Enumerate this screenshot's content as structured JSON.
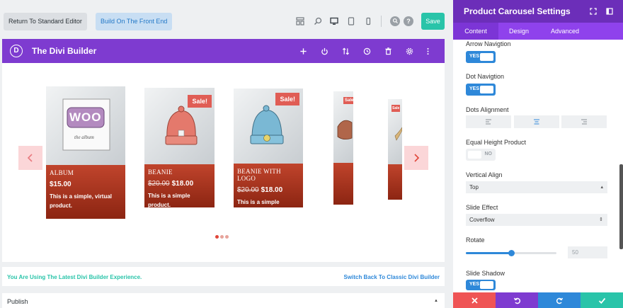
{
  "toolbar": {
    "return_label": "Return To Standard Editor",
    "front_end_label": "Build On The Front End",
    "save_label": "Save",
    "help_label": "?"
  },
  "builder": {
    "title": "The Divi Builder",
    "logo_letter": "D"
  },
  "carousel": {
    "products": [
      {
        "name": "ALBUM",
        "price": "$15.00",
        "old_price": "",
        "description": "This is a simple, virtual product.",
        "sale": ""
      },
      {
        "name": "BEANIE",
        "price": "$18.00",
        "old_price": "$20.00",
        "description": "This is a simple product.",
        "sale": "Sale!"
      },
      {
        "name": "BEANIE WITH LOGO",
        "price": "$18.00",
        "old_price": "$20.00",
        "description": "This is a simple product.",
        "sale": "Sale!"
      },
      {
        "name": "",
        "price": "",
        "old_price": "",
        "description": "",
        "sale": "Sale"
      },
      {
        "name": "",
        "price": "",
        "old_price": "",
        "description": "",
        "sale": "Sale"
      }
    ],
    "album_art_text": "WOO",
    "album_art_sub": "the album",
    "dots_total": 3,
    "dots_active": 0
  },
  "infobar": {
    "left": "You Are Using The Latest Divi Builder Experience.",
    "right": "Switch Back To Classic Divi Builder"
  },
  "publish": {
    "label": "Publish"
  },
  "panel": {
    "title": "Product Carousel Settings",
    "tabs": [
      "Content",
      "Design",
      "Advanced"
    ],
    "active_tab": "Content",
    "fields": {
      "arrow_nav": {
        "label": "Arrow Navigtion",
        "value": "YES"
      },
      "dot_nav": {
        "label": "Dot Navigtion",
        "value": "YES"
      },
      "dots_alignment": {
        "label": "Dots Alignment",
        "value": "center"
      },
      "equal_height": {
        "label": "Equal Height Product",
        "value": "NO"
      },
      "vertical_align": {
        "label": "Vertical Align",
        "value": "Top"
      },
      "slide_effect": {
        "label": "Slide Effect",
        "value": "Coverflow"
      },
      "rotate": {
        "label": "Rotate",
        "value": "50",
        "fraction": 0.5
      },
      "slide_shadow": {
        "label": "Slide Shadow",
        "value": "YES"
      }
    }
  },
  "colors": {
    "divi_purple": "#7e3bd0",
    "panel_purple": "#6c2eb9",
    "tab_purple": "#8f42ec",
    "save_teal": "#29c4a9",
    "toggle_blue": "#2e88d9",
    "cancel_red": "#ef5455",
    "undo_purple": "#7e3bd0",
    "redo_blue": "#2e88d9",
    "confirm_teal": "#29c4a9"
  }
}
